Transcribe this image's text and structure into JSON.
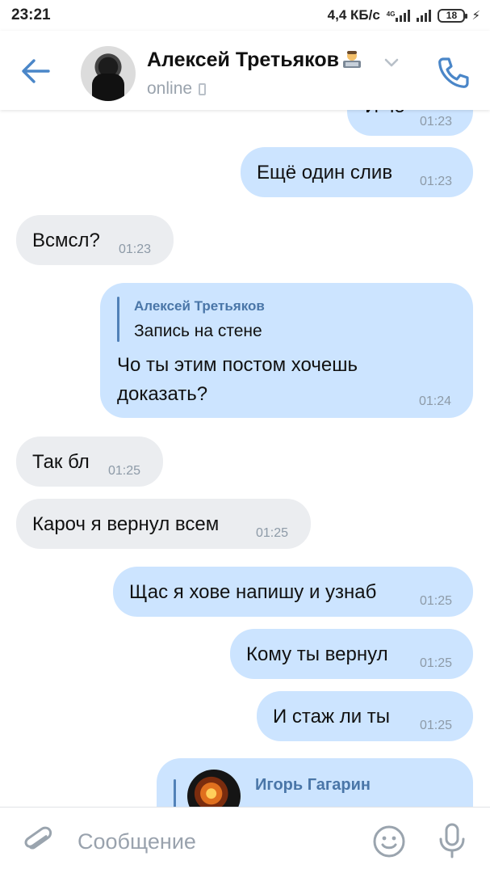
{
  "status_bar": {
    "time": "23:21",
    "speed": "4,4 КБ/с",
    "network": "4G",
    "battery": "18"
  },
  "header": {
    "contact_name": "Алексей Третьяков",
    "status": "online",
    "icons": [
      "back-arrow-icon",
      "chevron-down-icon",
      "phone-call-icon"
    ]
  },
  "messages": [
    {
      "dir": "out",
      "text": "И чо",
      "time": "01:23"
    },
    {
      "dir": "out",
      "text": "Ещё один слив",
      "time": "01:23"
    },
    {
      "dir": "in",
      "text": "Всмсл?",
      "time": "01:23"
    },
    {
      "dir": "out",
      "reply_author": "Алексей Третьяков",
      "reply_text": "Запись на стене",
      "text_line1": "Чо ты этим постом хочешь",
      "text_line2": "доказать?",
      "time": "01:24"
    },
    {
      "dir": "in",
      "text": "Так бл",
      "time": "01:25"
    },
    {
      "dir": "in",
      "text": "Кароч я вернул всем",
      "time": "01:25"
    },
    {
      "dir": "out",
      "text": "Щас я хове напишу и узнаб",
      "time": "01:25"
    },
    {
      "dir": "out",
      "text": "Кому ты вернул",
      "time": "01:25"
    },
    {
      "dir": "out",
      "text": "И стаж ли ты",
      "time": "01:25"
    },
    {
      "dir": "out",
      "reply_author": "Игорь Гагарин"
    }
  ],
  "input": {
    "placeholder": "Сообщение"
  },
  "colors": {
    "accent": "#4a76a8",
    "outgoing_bubble": "#cce4ff",
    "incoming_bubble": "#ebedf0",
    "time_text": "#8d9aa7"
  }
}
